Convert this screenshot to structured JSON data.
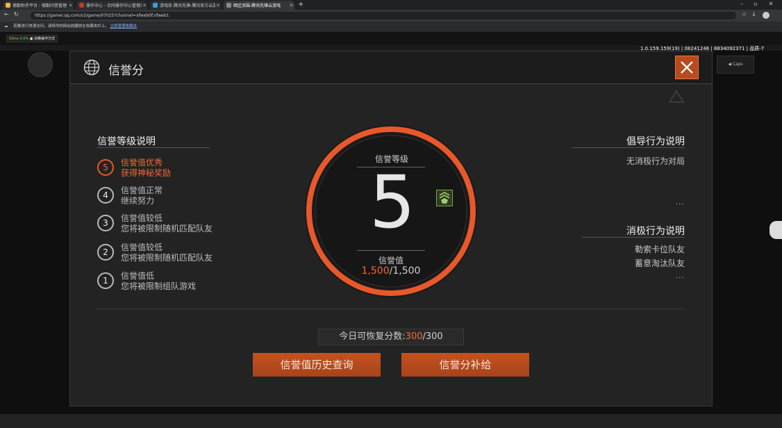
{
  "browser": {
    "tabs": [
      {
        "label": "德勤助手平台 - 德勤问答管理",
        "color": "#f1b74a",
        "active": false
      },
      {
        "label": "操作中心 - 合同操作中心管理系统",
        "color": "#c0392b",
        "active": false
      },
      {
        "label": "游戏库-腾讯先锋-腾讯官方云游戏",
        "color": "#3aa0d8",
        "active": false
      },
      {
        "label": "暗区突围-腾讯先锋云游戏",
        "color": "#888888",
        "active": true
      }
    ],
    "url": "https://gamer.qq.com/v2/game/97025?channel=xfweb0f.xfweb1",
    "info_text": "若要进行快速访问，请将你的网站收藏放在收藏夹栏上。",
    "info_link": "立即管理收藏夹"
  },
  "app": {
    "latency": "53ms",
    "loss": "0.0%",
    "mode": "切换操作方式",
    "version": "1.0.159.159(19) | 08241248 | 8834092371 | 品质-7",
    "caps": "Caps"
  },
  "modal": {
    "title": "信誉分",
    "left_title": "信誉等级说明",
    "levels": [
      {
        "num": "5",
        "line1": "信誉值优秀",
        "line2": "获得神秘奖励",
        "highlight": true
      },
      {
        "num": "4",
        "line1": "信誉值正常",
        "line2": "继续努力",
        "highlight": false
      },
      {
        "num": "3",
        "line1": "信誉值较低",
        "line2": "您将被限制随机匹配队友",
        "highlight": false
      },
      {
        "num": "2",
        "line1": "信誉值较低",
        "line2": "您将被限制随机匹配队友",
        "highlight": false
      },
      {
        "num": "1",
        "line1": "信誉值低",
        "line2": "您将被限制组队游戏",
        "highlight": false
      }
    ],
    "center": {
      "level_label": "信誉等级",
      "level": "5",
      "value_label": "信誉值",
      "value_current": "1,500",
      "value_sep": "/",
      "value_max": "1,500"
    },
    "right": {
      "advocate_title": "倡导行为说明",
      "advocate_items": [
        "无消极行为对局"
      ],
      "negative_title": "消极行为说明",
      "negative_items": [
        "勒索卡位队友",
        "蓄意淘汰队友"
      ],
      "more": "..."
    },
    "restore": {
      "label": "今日可恢复分数:",
      "current": "300",
      "sep": "/",
      "max": "300"
    },
    "buttons": {
      "history": "信誉值历史查询",
      "supply": "信誉分补给"
    }
  },
  "colors": {
    "accent": "#e8582a",
    "button": "#b1481c"
  }
}
